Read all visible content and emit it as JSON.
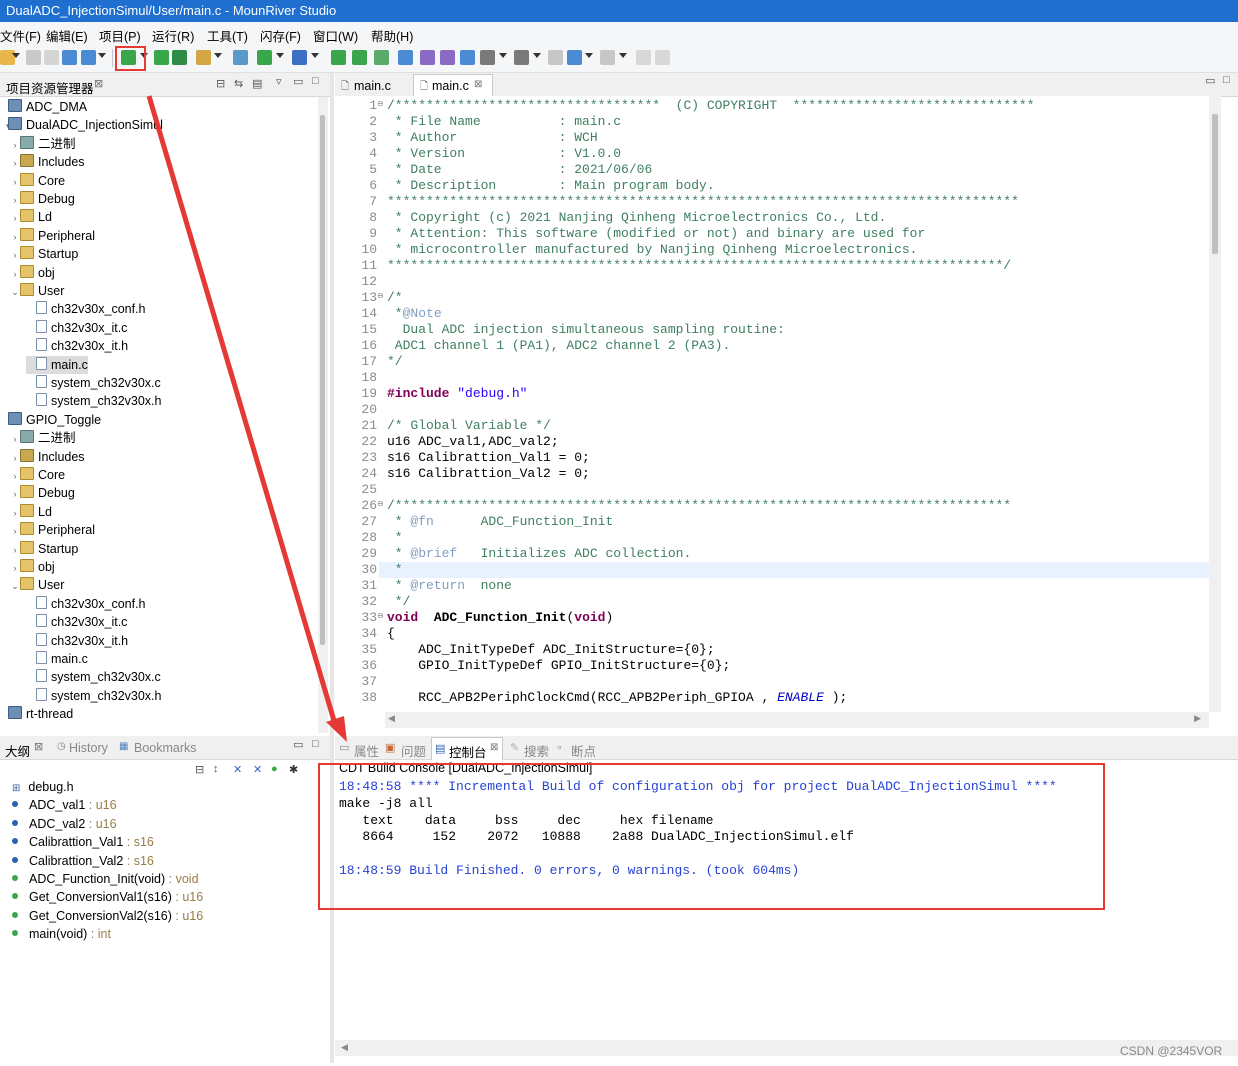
{
  "window": {
    "title": "DualADC_InjectionSimul/User/main.c - MounRiver Studio"
  },
  "menu": [
    "文件(F)",
    "编辑(E)",
    "项目(P)",
    "运行(R)",
    "工具(T)",
    "闪存(F)",
    "窗口(W)",
    "帮助(H)"
  ],
  "project_explorer": {
    "tab_label": "项目资源管理器",
    "rows": [
      {
        "label": "ADC_DMA"
      },
      {
        "label": "DualADC_InjectionSimul"
      },
      {
        "label": "二进制"
      },
      {
        "label": "Includes"
      },
      {
        "label": "Core"
      },
      {
        "label": "Debug"
      },
      {
        "label": "Ld"
      },
      {
        "label": "Peripheral"
      },
      {
        "label": "Startup"
      },
      {
        "label": "obj"
      },
      {
        "label": "User"
      },
      {
        "label": "ch32v30x_conf.h"
      },
      {
        "label": "ch32v30x_it.c"
      },
      {
        "label": "ch32v30x_it.h"
      },
      {
        "label": "main.c"
      },
      {
        "label": "system_ch32v30x.c"
      },
      {
        "label": "system_ch32v30x.h"
      },
      {
        "label": "GPIO_Toggle"
      },
      {
        "label": "二进制"
      },
      {
        "label": "Includes"
      },
      {
        "label": "Core"
      },
      {
        "label": "Debug"
      },
      {
        "label": "Ld"
      },
      {
        "label": "Peripheral"
      },
      {
        "label": "Startup"
      },
      {
        "label": "obj"
      },
      {
        "label": "User"
      },
      {
        "label": "ch32v30x_conf.h"
      },
      {
        "label": "ch32v30x_it.c"
      },
      {
        "label": "ch32v30x_it.h"
      },
      {
        "label": "main.c"
      },
      {
        "label": "system_ch32v30x.c"
      },
      {
        "label": "system_ch32v30x.h"
      },
      {
        "label": "rt-thread"
      }
    ]
  },
  "editor": {
    "tabs": [
      {
        "label": "main.c"
      },
      {
        "label": "main.c"
      }
    ],
    "lines": [
      {
        "n": "1",
        "text": "/**********************************  (C) COPYRIGHT  *******************************"
      },
      {
        "n": "2",
        "text": " * File Name          : main.c"
      },
      {
        "n": "3",
        "text": " * Author             : WCH"
      },
      {
        "n": "4",
        "text": " * Version            : V1.0.0"
      },
      {
        "n": "5",
        "text": " * Date               : 2021/06/06"
      },
      {
        "n": "6",
        "text": " * Description        : Main program body."
      },
      {
        "n": "7",
        "text": "*********************************************************************************"
      },
      {
        "n": "8",
        "text": " * Copyright (c) 2021 Nanjing Qinheng Microelectronics Co., Ltd."
      },
      {
        "n": "9",
        "text": " * Attention: This software (modified or not) and binary are used for"
      },
      {
        "n": "10",
        "text": " * microcontroller manufactured by Nanjing Qinheng Microelectronics."
      },
      {
        "n": "11",
        "text": "*******************************************************************************/"
      },
      {
        "n": "12",
        "text": ""
      },
      {
        "n": "13",
        "text": "/*"
      },
      {
        "n": "14",
        "text": " *@Note"
      },
      {
        "n": "15",
        "text": "  Dual ADC injection simultaneous sampling routine:"
      },
      {
        "n": "16",
        "text": " ADC1 channel 1 (PA1), ADC2 channel 2 (PA3)."
      },
      {
        "n": "17",
        "text": "*/"
      },
      {
        "n": "18",
        "text": ""
      },
      {
        "n": "19",
        "text": "#include \"debug.h\""
      },
      {
        "n": "20",
        "text": ""
      },
      {
        "n": "21",
        "text": "/* Global Variable */"
      },
      {
        "n": "22",
        "text": "u16 ADC_val1,ADC_val2;"
      },
      {
        "n": "23",
        "text": "s16 Calibrattion_Val1 = 0;"
      },
      {
        "n": "24",
        "text": "s16 Calibrattion_Val2 = 0;"
      },
      {
        "n": "25",
        "text": ""
      },
      {
        "n": "26",
        "text": "/*******************************************************************************"
      },
      {
        "n": "27",
        "text": " * @fn      ADC_Function_Init"
      },
      {
        "n": "28",
        "text": " *"
      },
      {
        "n": "29",
        "text": " * @brief   Initializes ADC collection."
      },
      {
        "n": "30",
        "text": " *"
      },
      {
        "n": "31",
        "text": " * @return  none"
      },
      {
        "n": "32",
        "text": " */"
      },
      {
        "n": "33",
        "text": "void  ADC_Function_Init(void)"
      },
      {
        "n": "34",
        "text": "{"
      },
      {
        "n": "35",
        "text": "    ADC_InitTypeDef ADC_InitStructure={0};"
      },
      {
        "n": "36",
        "text": "    GPIO_InitTypeDef GPIO_InitStructure={0};"
      },
      {
        "n": "37",
        "text": ""
      },
      {
        "n": "38",
        "text": "    RCC_APB2PeriphClockCmd(RCC_APB2Periph_GPIOA , ENABLE );"
      }
    ]
  },
  "outline": {
    "tabs": [
      "大纲",
      "History",
      "Bookmarks"
    ],
    "items": [
      {
        "name": "debug.h",
        "type": ""
      },
      {
        "name": "ADC_val1",
        "type": " : u16"
      },
      {
        "name": "ADC_val2",
        "type": " : u16"
      },
      {
        "name": "Calibrattion_Val1",
        "type": " : s16"
      },
      {
        "name": "Calibrattion_Val2",
        "type": " : s16"
      },
      {
        "name": "ADC_Function_Init(void)",
        "type": " : void"
      },
      {
        "name": "Get_ConversionVal1(s16)",
        "type": " : u16"
      },
      {
        "name": "Get_ConversionVal2(s16)",
        "type": " : u16"
      },
      {
        "name": "main(void)",
        "type": " : int"
      }
    ]
  },
  "bottom_tabs": [
    "属性",
    "问题",
    "控制台",
    "搜索",
    "断点"
  ],
  "console": {
    "title": "CDT Build Console [DualADC_InjectionSimul]",
    "lines": [
      "18:48:58 **** Incremental Build of configuration obj for project DualADC_InjectionSimul ****",
      "make -j8 all",
      "   text    data     bss     dec     hex filename",
      "   8664     152    2072   10888    2a88 DualADC_InjectionSimul.elf",
      "",
      "18:48:59 Build Finished. 0 errors, 0 warnings. (took 604ms)"
    ]
  },
  "watermark": "CSDN @2345VOR",
  "colors": {
    "annotation": "#e53935",
    "titlebar": "#1e6fd0",
    "console_blue": "#2742d8"
  }
}
